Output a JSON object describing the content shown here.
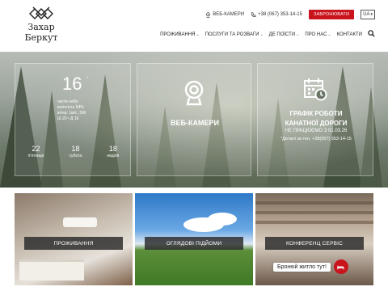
{
  "logo": {
    "line1": "Захар",
    "line2": "Беркут"
  },
  "topbar": {
    "webcams": "ВЕБ-КАМЕРИ",
    "phone": "+38 (067) 353-14-15",
    "book_button": "ЗАБРОНЮВАТИ",
    "language": "UA"
  },
  "nav": {
    "items": [
      {
        "label": "ПРОЖИВАННЯ",
        "has_dropdown": true
      },
      {
        "label": "ПОСЛУГИ ТА РОЗВАГИ",
        "has_dropdown": true
      },
      {
        "label": "ДЕ ПОЇСТИ",
        "has_dropdown": true
      },
      {
        "label": "ПРО НАС",
        "has_dropdown": true
      },
      {
        "label": "КОНТАКТИ",
        "has_dropdown": false
      }
    ]
  },
  "weather": {
    "temp": "16",
    "unit": "°",
    "lines": [
      "чисте небо",
      "вологість 54%",
      "вітер: 1м/с, SW",
      "Ш 20 • Д 16"
    ],
    "forecast": [
      {
        "temp": "22",
        "day": "п'ятниця"
      },
      {
        "temp": "18",
        "day": "субота"
      },
      {
        "temp": "18",
        "day": "неділя"
      }
    ]
  },
  "webcams_panel": {
    "title": "ВЕБ-КАМЕРИ"
  },
  "cableway": {
    "title_line1": "ГРАФІК РОБОТИ",
    "title_line2": "КАНАТНОЇ ДОРОГИ",
    "note1": "НЕ ПРАЦЮЄМО З 01.03.26",
    "note2": "*Деталі за тел. +38(067) 353-14-15"
  },
  "cards": [
    {
      "label": "ПРОЖИВАННЯ"
    },
    {
      "label": "ОГЛЯДОВІ ПІДЙОМИ"
    },
    {
      "label": "КОНФЕРЕНЦ СЕРВІС"
    }
  ],
  "booking_widget": {
    "text": "Бронюй житло тут!"
  },
  "colors": {
    "accent": "#c9131d"
  }
}
